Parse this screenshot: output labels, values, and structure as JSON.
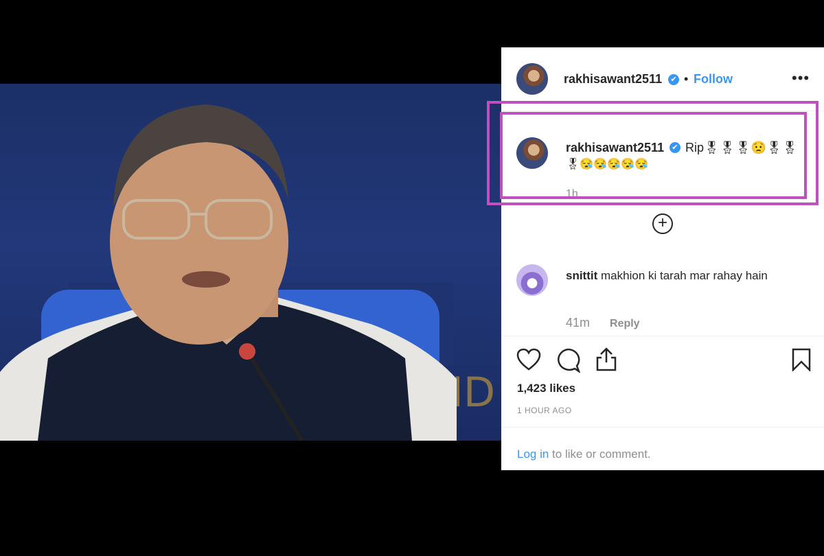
{
  "post": {
    "username": "rakhisawant2511",
    "verified_mark": "✔",
    "dot": "•",
    "follow_label": "Follow",
    "more_label": "•••"
  },
  "caption": {
    "username": "rakhisawant2511",
    "text_line1": "Rip🎖🎖🎖😟🎖🎖",
    "text_line2": "🎖😪😪😪😪😪",
    "time": "1h"
  },
  "load_more": "+",
  "comment": {
    "username": "snittit",
    "text": "makhion ki tarah mar rahay hain",
    "time": "41m",
    "reply_label": "Reply"
  },
  "stats": {
    "likes": "1,423 likes",
    "posted_ago": "1 HOUR AGO"
  },
  "footer": {
    "login_link": "Log in",
    "login_text": " to like or comment."
  },
  "colors": {
    "accent": "#3897f0",
    "highlight": "#c04fbf",
    "muted": "#8e8e8e"
  },
  "icons": [
    "heart-icon",
    "comment-icon",
    "share-icon",
    "bookmark-icon",
    "verified-icon",
    "more-icon",
    "plus-circle-icon"
  ]
}
